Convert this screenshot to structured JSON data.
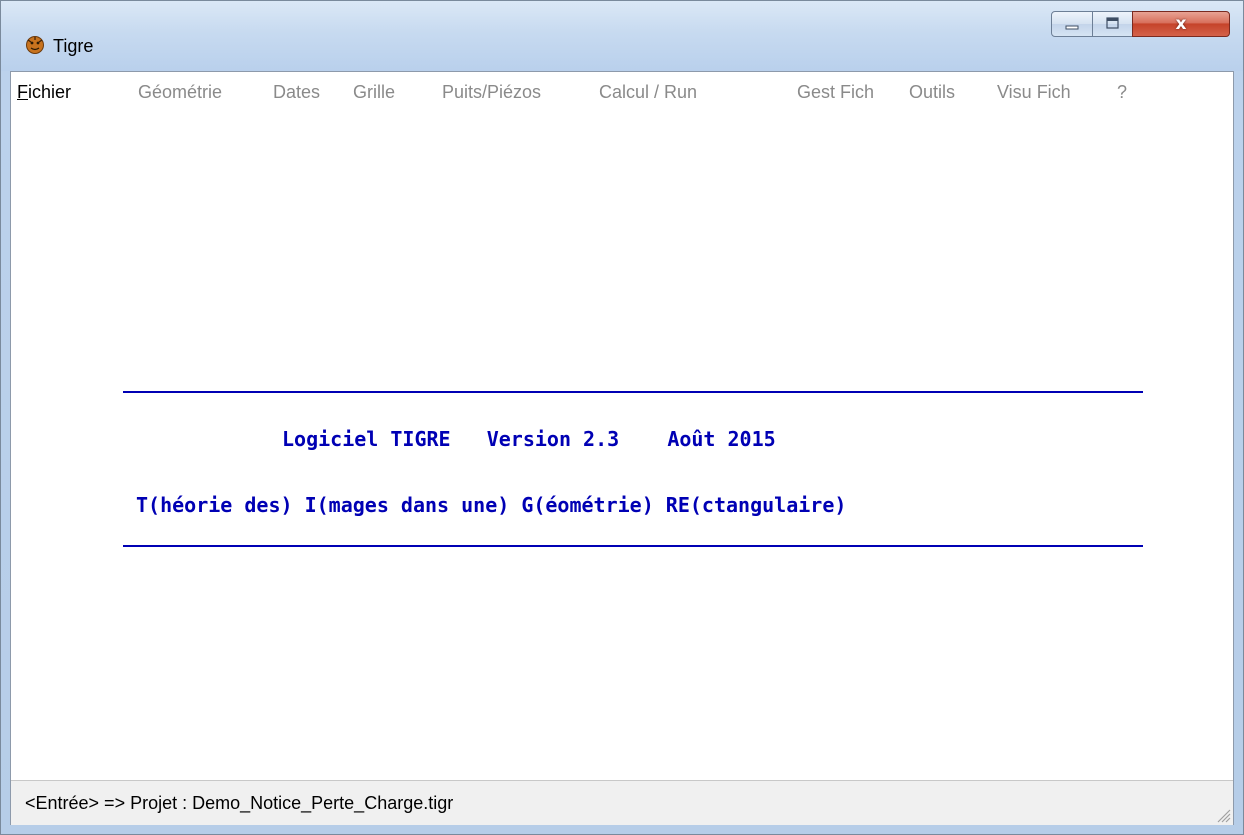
{
  "window": {
    "title": "Tigre",
    "close_glyph": "x"
  },
  "menu": {
    "items": [
      {
        "label": "Fichier",
        "enabled": true,
        "mnemonic": "F",
        "rest": "ichier"
      },
      {
        "label": "Géométrie",
        "enabled": false
      },
      {
        "label": "Dates",
        "enabled": false
      },
      {
        "label": "Grille",
        "enabled": false
      },
      {
        "label": "Puits/Piézos",
        "enabled": false
      },
      {
        "label": "Calcul / Run",
        "enabled": false
      },
      {
        "label": "Gest Fich",
        "enabled": false
      },
      {
        "label": "Outils",
        "enabled": false
      },
      {
        "label": "Visu Fich",
        "enabled": false
      },
      {
        "label": "?",
        "enabled": false
      }
    ]
  },
  "banner": {
    "line1": "Logiciel TIGRE   Version 2.3    Août 2015",
    "line2": "T(héorie des) I(mages dans une) G(éométrie) RE(ctangulaire)",
    "color": "#0000b4"
  },
  "status": {
    "text": "<Entrée> => Projet : Demo_Notice_Perte_Charge.tigr"
  }
}
